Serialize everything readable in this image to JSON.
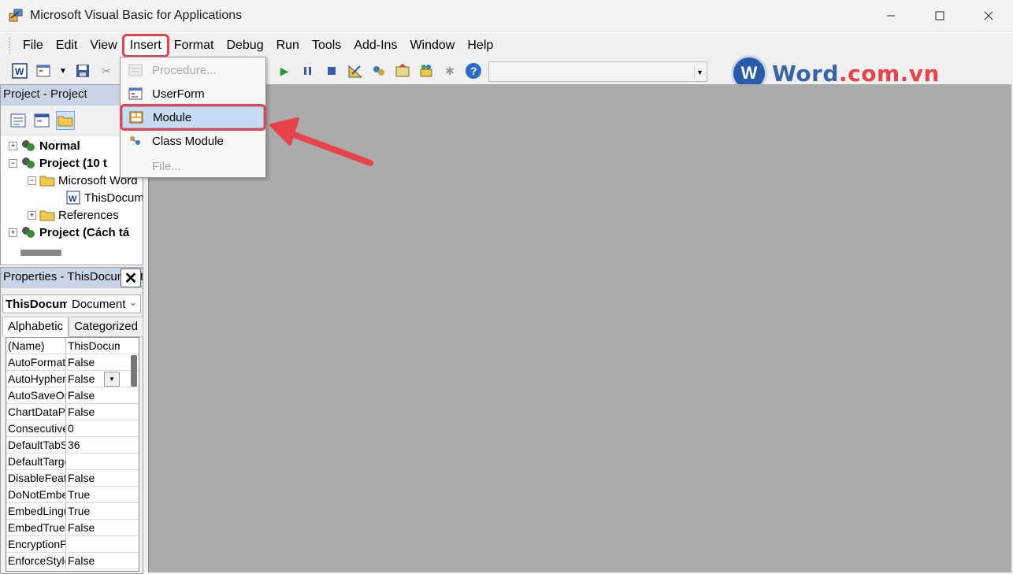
{
  "window": {
    "title": "Microsoft Visual Basic for Applications",
    "minimize_icon": "minimize-icon",
    "maximize_icon": "maximize-icon",
    "close_icon": "close-icon"
  },
  "menubar": {
    "items": [
      "File",
      "Edit",
      "View",
      "Insert",
      "Format",
      "Debug",
      "Run",
      "Tools",
      "Add-Ins",
      "Window",
      "Help"
    ],
    "highlighted": "Insert"
  },
  "insert_menu": {
    "items": [
      {
        "label": "Procedure...",
        "enabled": false,
        "icon": "procedure-icon"
      },
      {
        "label": "UserForm",
        "enabled": true,
        "icon": "userform-icon"
      },
      {
        "label": "Module",
        "enabled": true,
        "selected": true,
        "icon": "module-icon"
      },
      {
        "label": "Class Module",
        "enabled": true,
        "icon": "class-module-icon"
      },
      {
        "label": "File...",
        "enabled": false,
        "icon": ""
      }
    ]
  },
  "logo": {
    "letter": "W",
    "text_a": "Word",
    "text_b": ".com.vn"
  },
  "project_panel": {
    "title": "Project - Project",
    "tree": [
      {
        "label": "Normal",
        "bold": true
      },
      {
        "label": "Project (10 t",
        "bold": true
      },
      {
        "label": "Microsoft Word",
        "bold": false
      },
      {
        "label": "ThisDocum",
        "bold": false
      },
      {
        "label": "References",
        "bold": false
      },
      {
        "label": "Project (Cách tá",
        "bold": true
      }
    ]
  },
  "properties_panel": {
    "title": "Properties - ThisDocument",
    "object_name": "ThisDocument",
    "object_type": "Document",
    "tabs": [
      "Alphabetic",
      "Categorized"
    ],
    "rows": [
      {
        "name": "(Name)",
        "value": "ThisDocument"
      },
      {
        "name": "AutoFormatOverride",
        "value": "False"
      },
      {
        "name": "AutoHyphenation",
        "value": "False"
      },
      {
        "name": "AutoSaveOn",
        "value": "False"
      },
      {
        "name": "ChartDataPointTrack",
        "value": "False"
      },
      {
        "name": "ConsecutiveHyphensLimit",
        "value": "0"
      },
      {
        "name": "DefaultTabStop",
        "value": "36"
      },
      {
        "name": "DefaultTargetFrame",
        "value": ""
      },
      {
        "name": "DisableFeatures",
        "value": "False"
      },
      {
        "name": "DoNotEmbedSystemFonts",
        "value": "True"
      },
      {
        "name": "EmbedLinguisticData",
        "value": "True"
      },
      {
        "name": "EmbedTrueTypeFonts",
        "value": "False"
      },
      {
        "name": "EncryptionProvider",
        "value": ""
      },
      {
        "name": "EnforceStyle",
        "value": "False"
      }
    ]
  },
  "colors": {
    "highlight_red": "#e8434a",
    "panel_header": "#c9d5e6",
    "selected_item": "#c5dcf3",
    "workspace": "#ababab"
  }
}
